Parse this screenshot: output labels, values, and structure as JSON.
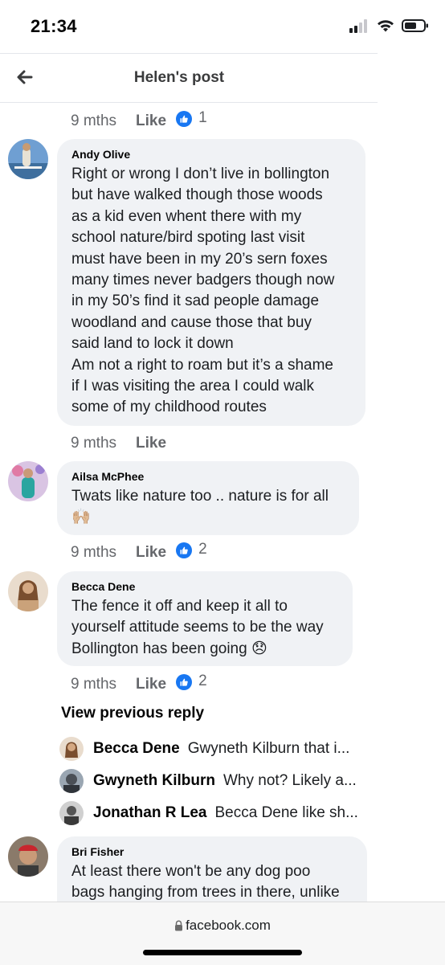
{
  "status_bar": {
    "time": "21:34"
  },
  "header": {
    "title": "Helen's post"
  },
  "top_meta": {
    "time": "9 mths",
    "like_label": "Like",
    "like_count": "1"
  },
  "comments": [
    {
      "author": "Andy Olive",
      "text": "Right or wrong I don’t live in bollington\nbut have walked though those woods\nas a kid even whent there with my\nschool nature/bird spoting last visit\nmust have been in my 20’s sern foxes\nmany times never badgers though now\nin my 50’s find it sad people damage\nwoodland and cause those that buy\nsaid land to lock it down\nAm not a right to roam but it’s a shame\nif I was visiting the area I could walk\nsome of my childhood routes",
      "time": "9 mths",
      "like_label": "Like",
      "like_count": ""
    },
    {
      "author": "Ailsa McPhee",
      "text": "Twats like nature too .. nature is for all\n🙌🏼",
      "time": "9 mths",
      "like_label": "Like",
      "like_count": "2"
    },
    {
      "author": "Becca Dene",
      "text": "The fence it off and keep it all to\nyourself attitude seems to be the way\nBollington has been going 😞",
      "time": "9 mths",
      "like_label": "Like",
      "like_count": "2"
    },
    {
      "author": "Bri Fisher",
      "text": "At least there won't be any dog poo\nbags hanging from trees in there, unlike",
      "time": "",
      "like_label": "",
      "like_count": ""
    }
  ],
  "view_previous_reply": "View previous reply",
  "replies": [
    {
      "author": "Becca Dene",
      "text": "Gwyneth Kilburn that i..."
    },
    {
      "author": "Gwyneth Kilburn",
      "text": "Why not? Likely a..."
    },
    {
      "author": "Jonathan R Lea",
      "text": "Becca Dene like sh..."
    }
  ],
  "browser": {
    "url": "facebook.com"
  },
  "colors": {
    "like_blue": "#1877f2",
    "bubble_bg": "#f0f2f5",
    "meta_grey": "#65676b"
  }
}
